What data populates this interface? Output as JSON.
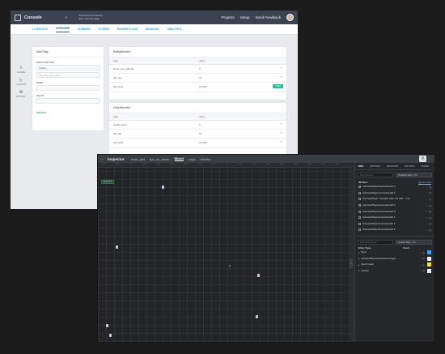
{
  "console": {
    "brand": "Console",
    "project_line1": "Sss-test-new-tracking",
    "project_line2": "EIS / hermes-edge",
    "nav": [
      "Projects",
      "Setup",
      "Send Feedback"
    ],
    "tabs": [
      "LI SERCETS",
      "OVERVIEW",
      "RUNNERS",
      "STORES",
      "RUNNER FLAGS",
      "BEHAVIOR",
      "ANALYTICS"
    ],
    "active_tab_index": 1,
    "sidebar": [
      {
        "icon": "share-icon",
        "glyph": "<",
        "label": "SHARE"
      },
      {
        "icon": "play-icon",
        "glyph": "▷",
        "label": "LAUNCH"
      },
      {
        "icon": "gear-icon",
        "glyph": "⚙",
        "label": "EXPORT"
      }
    ],
    "add_flag": {
      "title": "Add Flag",
      "type_label": "BOOLEAN TYPE",
      "type_value": "Online...",
      "type_hint": "flag_key_goes_here",
      "name_label": "NAME",
      "value_label": "VALUE",
      "add_link": "ENABLE"
    },
    "entity_monitor": {
      "title": "EntityMonitor",
      "headers": [
        "Flag",
        "Value"
      ],
      "rows": [
        {
          "flag": "show_npc_adrenal",
          "value": "0"
        },
        {
          "flag": "dim-ray",
          "value": "10"
        },
        {
          "flag": "dim-point",
          "value": "10,000"
        }
      ],
      "save_label": "SAVE"
    },
    "other_monitor": {
      "title": "OtherMonitor",
      "headers": [
        "Flag",
        "Value"
      ],
      "rows": [
        {
          "flag": "quality_level",
          "value": "0"
        },
        {
          "flag": "dim-ray",
          "value": "10"
        },
        {
          "flag": "dim-point",
          "value": "10,000"
        }
      ]
    }
  },
  "inspector": {
    "title": "Inspector",
    "tabs": [
      "solar_grid",
      "fps_on_demo",
      "World",
      "Logs",
      "Monitor"
    ],
    "active_tab_index": 2,
    "ruler_ticks": [
      "-1.44",
      "-1.28",
      "-1.12",
      "-0.96",
      "-0.80",
      "-0.64",
      "-0.48",
      "-0.32",
      "-0.16",
      "0",
      "0.16",
      "0.32",
      "0.48",
      "0.64",
      "0.80",
      "0.96",
      "1.12",
      "1.28"
    ],
    "viewport_chip": "Entity Sel",
    "panel_tabs": [
      "VIEW",
      "ENTITIES",
      "BEHAVIOR",
      "PHYSICS",
      "SCENE"
    ],
    "active_panel_tab_index": 0,
    "filter_placeholder": "Filter Workers",
    "filter_select": "Predicate Warn - Tm",
    "workers_title": "Workers",
    "workers_link": "Ignore Local",
    "workers": [
      "InterestedPlayerAreaInstanceID 0",
      "InterestedPlayerAreaInstanceID 3",
      "InterestedPlayer: ssssskdf: walk: mhr shift: : 3.3m",
      "InterestedPlayerAreaInstanceID 0",
      "InterestedPlayerAreaInstanceID 0",
      "InterestedPlayerAreaInstanceID 3",
      "InterestedPlayerAreaInstanceID 0",
      "InterestedPlayerAreaInstanceID 0"
    ],
    "entity_filter_placeholder": "Filter Entity Types",
    "entity_select": "Custom Style - Tm",
    "entity_types_header": [
      "Entity Types",
      "Count"
    ],
    "entity_types": [
      {
        "name": "Player",
        "color": "#3da0f0"
      },
      {
        "name": "InterestedPlayerAreaInstanceTrigger",
        "color": "#f2f2f2"
      },
      {
        "name": "PlayerCreator",
        "color": "#f2e14a"
      },
      {
        "name": "IsSoldier",
        "color": "#f2f2f2"
      }
    ]
  }
}
